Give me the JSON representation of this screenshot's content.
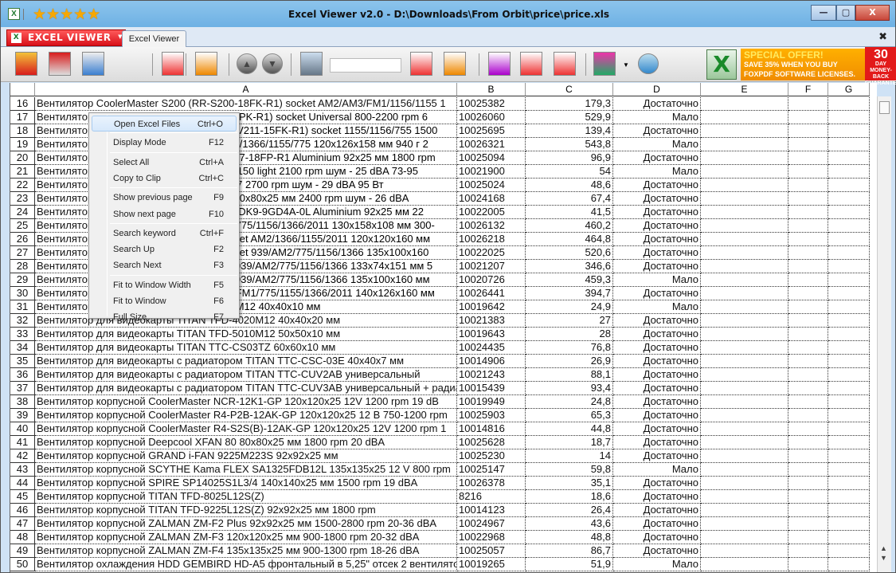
{
  "window": {
    "title": "Excel Viewer v2.0 - D:\\Downloads\\From Orbit\\price\\price.xls",
    "stars": "★★★★★",
    "minimize": "—",
    "maximize": "▢",
    "close": "X"
  },
  "tabs": {
    "brand": "EXCEL VIEWER",
    "active_tab": "Excel Viewer",
    "close": "✖"
  },
  "toolbar": {
    "search_value": "",
    "promo": {
      "line1": "SPECIAL OFFER!",
      "line2": "SAVE 35% WHEN YOU BUY",
      "line3": "FOXPDF SOFTWARE LICENSES.",
      "days": "30",
      "day": "DAY",
      "guarantee": "MONEY-BACK GUARANTEE"
    },
    "icons": [
      "open-excel-icon",
      "print-icon",
      "display-mode-icon",
      "select-all-icon",
      "copy-icon",
      "copy-clip-icon",
      "arrow-up-icon",
      "arrow-down-icon",
      "search-icon",
      "previous-page-icon",
      "next-page-icon",
      "fit-width-icon",
      "fit-window-icon",
      "full-size-icon",
      "spell-abc-icon",
      "globe-icon"
    ]
  },
  "colors": {
    "brand_red": "#d8101a",
    "titlebar": "#6eb1e4",
    "promo_orange": "#f08c00"
  },
  "columns": [
    "A",
    "B",
    "C",
    "D",
    "E",
    "F",
    "G"
  ],
  "rows": [
    [
      "16",
      "Вентилятор  CoolerMaster  S200  (RR-S200-18FK-R1) socket  AM2/AM3/FM1/1156/1155  1",
      "",
      "10025382",
      "179,3",
      "Достаточно"
    ],
    [
      "17",
      "Вентилятор",
      "T-22PK-R1)  socket Universal  800-2200 rpm  6",
      "10026060",
      "529,9",
      "Мало"
    ],
    [
      "18",
      "Вентилятор",
      "RR-V211-15FK-R1) socket 1155/1156/755 1500",
      "10025695",
      "139,4",
      "Достаточно"
    ],
    [
      "19",
      "Вентилятор",
      "AM2/1366/1155/775  120x126x158 мм 940 г 2",
      "10026321",
      "543,8",
      "Мало"
    ],
    [
      "20",
      "Вентилятор",
      "-X117-18FP-R1  Aluminium  92x25 мм  1800 rpm",
      "10025094",
      "96,9",
      "Достаточно"
    ],
    [
      "21",
      "Вентилятор",
      "lut  1150  light  2100 rpm шум - 25 dBA  73-95",
      "10021900",
      "54",
      "Мало"
    ],
    [
      "22",
      "Вентилятор",
      "36S7  2700 rpm  шум - 29 dBA  95 Вт",
      "10025024",
      "48,6",
      "Достаточно"
    ],
    [
      "23",
      "Вентилятор",
      "S3  80x80x25 мм  2400 rpm  шум - 26 dBA",
      "10024168",
      "67,4",
      "Достаточно"
    ],
    [
      "24",
      "Вентилятор",
      "ster  DK9-9GD4A-0L  Aluminium  92x25 мм  22",
      "10022005",
      "41,5",
      "Достаточно"
    ],
    [
      "25",
      "Вентилятор",
      "M2/775/1156/1366/2011 130x158x108 мм  300-",
      "10026132",
      "460,2",
      "Достаточно"
    ],
    [
      "26",
      "Вентилятор",
      "  socket  AM2/1366/1155/2011  120x120x160 мм",
      "10026218",
      "464,8",
      "Достаточно"
    ],
    [
      "27",
      "Вентилятор",
      "socket  939/AM2/775/1156/1366  135x100x160",
      "10022025",
      "520,6",
      "Достаточно"
    ],
    [
      "28",
      "Вентилятор",
      "ket  939/AM2/775/1156/1366 133x74x151 мм 5",
      "10021207",
      "346,6",
      "Достаточно"
    ],
    [
      "29",
      "Вентилятор",
      "ket  939/AM2/775/1156/1366  135x100x160 мм",
      "10020726",
      "459,3",
      "Мало"
    ],
    [
      "30",
      "Вентилятор",
      "M2/FM1/775/1155/1366/2011 140x126x160 мм",
      "10026441",
      "394,7",
      "Достаточно"
    ],
    [
      "31",
      "Вентилятор",
      "010M12  40x40x10 мм",
      "10019642",
      "24,9",
      "Мало"
    ],
    [
      "32",
      "Вентилятор  для видеокарты  TITAN  TFD-4020M12  40x40x20 мм",
      "",
      "10021383",
      "27",
      "Достаточно"
    ],
    [
      "33",
      "Вентилятор  для видеокарты  TITAN  TFD-5010M12  50x50x10 мм",
      "",
      "10019643",
      "28",
      "Достаточно"
    ],
    [
      "34",
      "Вентилятор  для видеокарты  TITAN  TTC-CS03TZ  60x60x10 мм",
      "",
      "10024435",
      "76,8",
      "Достаточно"
    ],
    [
      "35",
      "Вентилятор  для видеокарты с радиатором  TITAN  TTC-CSC-03E  40x40x7 мм",
      "",
      "10014906",
      "26,9",
      "Достаточно"
    ],
    [
      "36",
      "Вентилятор  для видеокарты с радиатором  TITAN  TTC-CUV2AB универсальный",
      "",
      "10021243",
      "88,1",
      "Достаточно"
    ],
    [
      "37",
      "Вентилятор  для видеокарты с радиатором  TITAN  TTC-CUV3AB универсальный + радиатор",
      "",
      "10015439",
      "93,4",
      "Достаточно"
    ],
    [
      "38",
      "Вентилятор корпусной  CoolerMaster  NCR-12K1-GP  120x120x25  12V 1200 rpm  19 dB",
      "",
      "10019949",
      "24,8",
      "Достаточно"
    ],
    [
      "39",
      "Вентилятор корпусной  CoolerMaster  R4-P2B-12AK-GP  120x120x25  12 B 750-1200 rpm",
      "",
      "10025903",
      "65,3",
      "Достаточно"
    ],
    [
      "40",
      "Вентилятор корпусной  CoolerMaster  R4-S2S(B)-12AK-GP  120x120x25  12V 1200 rpm  1",
      "",
      "10014816",
      "44,8",
      "Достаточно"
    ],
    [
      "41",
      "Вентилятор корпусной  Deepcool  XFAN 80  80x80x25 мм  1800 rpm  20 dBA",
      "",
      "10025628",
      "18,7",
      "Достаточно"
    ],
    [
      "42",
      "Вентилятор корпусной  GRAND  i-FAN  9225M223S  92x92x25 мм",
      "",
      "10025230",
      "14",
      "Достаточно"
    ],
    [
      "43",
      "Вентилятор корпусной  SCYTHE  Kama FLEX  SA1325FDB12L  135x135x25  12 V 800 rpm",
      "",
      "10025147",
      "59,8",
      "Мало"
    ],
    [
      "44",
      "Вентилятор корпусной  SPIRE  SP14025S1L3/4  140x140x25 мм  1500 rpm  19 dBA",
      "",
      "10026378",
      "35,1",
      "Достаточно"
    ],
    [
      "45",
      "Вентилятор корпусной  TITAN  TFD-8025L12S(Z)",
      "",
      "8216",
      "18,6",
      "Достаточно"
    ],
    [
      "46",
      "Вентилятор корпусной  TITAN  TFD-9225L12S(Z)  92x92x25 мм  1800 rpm",
      "",
      "10014123",
      "26,4",
      "Достаточно"
    ],
    [
      "47",
      "Вентилятор корпусной  ZALMAN  ZM-F2  Plus  92x92x25 мм  1500-2800 rpm  20-36 dBA",
      "",
      "10024967",
      "43,6",
      "Достаточно"
    ],
    [
      "48",
      "Вентилятор корпусной  ZALMAN  ZM-F3  120x120x25 мм  900-1800 rpm  20-32 dBA",
      "",
      "10022968",
      "48,8",
      "Достаточно"
    ],
    [
      "49",
      "Вентилятор корпусной  ZALMAN  ZM-F4  135x135x25 мм  900-1300 rpm  18-26 dBA",
      "",
      "10025057",
      "86,7",
      "Достаточно"
    ],
    [
      "50",
      "Вентилятор охлаждения HDD  GEMBIRD  HD-A5  фронтальный в 5,25\" отсек 2 вентилятора",
      "",
      "10019265",
      "51,9",
      "Мало"
    ]
  ],
  "context_menu": [
    {
      "label": "Open Excel Files",
      "key": "Ctrl+O",
      "highlighted": true
    },
    {
      "sep": true
    },
    {
      "label": "Display Mode",
      "key": "F12"
    },
    {
      "sep": true
    },
    {
      "label": "Select All",
      "key": "Ctrl+A"
    },
    {
      "label": "Copy to Clip",
      "key": "Ctrl+C"
    },
    {
      "sep": true
    },
    {
      "label": "Show previous page",
      "key": "F9"
    },
    {
      "label": "Show next page",
      "key": "F10"
    },
    {
      "sep": true
    },
    {
      "label": "Search keyword",
      "key": "Ctrl+F"
    },
    {
      "label": "Search Up",
      "key": "F2"
    },
    {
      "label": "Search Next",
      "key": "F3"
    },
    {
      "sep": true
    },
    {
      "label": "Fit to Window Width",
      "key": "F5"
    },
    {
      "label": "Fit to Window",
      "key": "F6"
    },
    {
      "label": "Full Size",
      "key": "F7"
    }
  ]
}
